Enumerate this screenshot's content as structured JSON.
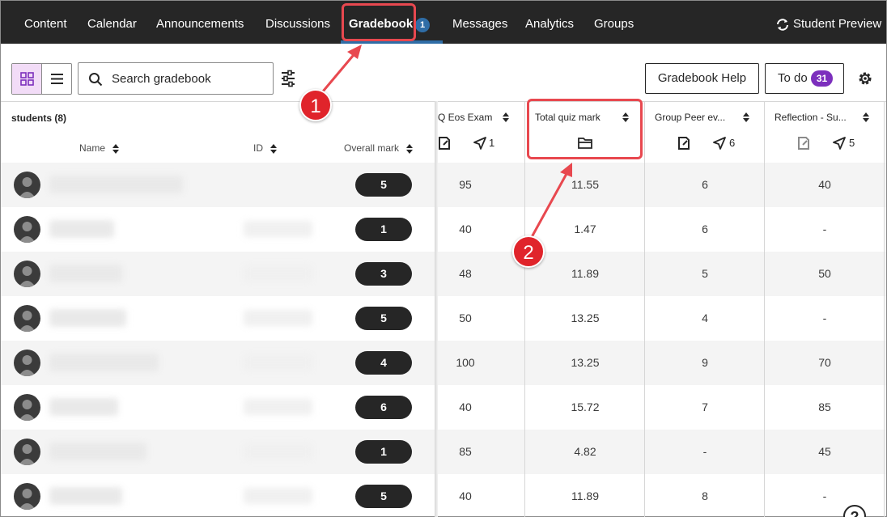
{
  "nav": {
    "tabs": [
      "Content",
      "Calendar",
      "Announcements",
      "Discussions",
      "Gradebook",
      "Messages",
      "Analytics",
      "Groups"
    ],
    "active_tab": "Gradebook",
    "gradebook_badge": "1",
    "student_preview": "Student Preview"
  },
  "toolbar": {
    "search_placeholder": "Search gradebook",
    "help_label": "Gradebook Help",
    "todo_label": "To do",
    "todo_count": "31"
  },
  "grid": {
    "students_title": "students (8)",
    "columns": {
      "name": "Name",
      "id": "ID",
      "overall": "Overall mark",
      "exam": "Q Eos Exam",
      "exam_submitted": "1",
      "quiz": "Total quiz mark",
      "peer": "Group Peer ev...",
      "peer_submitted": "6",
      "reflection": "Reflection - Su...",
      "reflection_submitted": "5"
    },
    "rows": [
      {
        "overall": "5",
        "exam": "95",
        "quiz": "11.55",
        "peer": "6",
        "reflection": "40"
      },
      {
        "overall": "1",
        "exam": "40",
        "quiz": "1.47",
        "peer": "6",
        "reflection": "-"
      },
      {
        "overall": "3",
        "exam": "48",
        "quiz": "11.89",
        "peer": "5",
        "reflection": "50"
      },
      {
        "overall": "5",
        "exam": "50",
        "quiz": "13.25",
        "peer": "4",
        "reflection": "-"
      },
      {
        "overall": "4",
        "exam": "100",
        "quiz": "13.25",
        "peer": "9",
        "reflection": "70"
      },
      {
        "overall": "6",
        "exam": "40",
        "quiz": "15.72",
        "peer": "7",
        "reflection": "85"
      },
      {
        "overall": "1",
        "exam": "85",
        "quiz": "4.82",
        "peer": "-",
        "reflection": "45"
      },
      {
        "overall": "5",
        "exam": "40",
        "quiz": "11.89",
        "peer": "8",
        "reflection": "-"
      }
    ]
  },
  "annotations": {
    "callout_1": "1",
    "callout_2": "2",
    "callout_color": "#e0242b"
  },
  "colors": {
    "nav_bg": "#262626",
    "accent_blue": "#2f6da6",
    "todo_purple": "#7c2fbd",
    "grid_view_bg": "#f2dcf7"
  }
}
